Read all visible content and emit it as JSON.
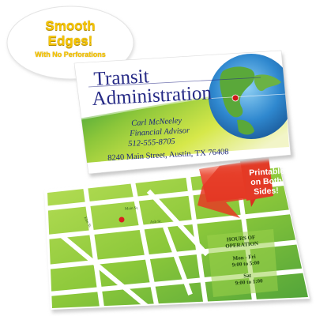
{
  "badge": {
    "line1": "Smooth",
    "line2": "Edges!",
    "line3": "With No Perforations"
  },
  "business_card": {
    "title_line1": "Transit",
    "title_line2": "Administration",
    "name": "Carl McNeeley",
    "role": "Financial Advisor",
    "phone": "512-555-8705",
    "address": "8240 Main Street, Austin, TX 76408"
  },
  "arrow_label": {
    "line1": "Printable",
    "line2": "on Both",
    "line3": "Sides!"
  },
  "map_card": {
    "streets": [
      "Main St.",
      "Ash St.",
      "Elm St."
    ],
    "hours_title_line1": "HOURS OF",
    "hours_title_line2": "OPERATION",
    "days1": "Mon - Fri",
    "time1": "9:00 to 5:00",
    "days2": "Sat",
    "time2": "9:00 to 1:00"
  },
  "colors": {
    "badge_text": "#f6c400",
    "title_text": "#262a86",
    "arrow_red": "#e0301e",
    "map_green": "#86c232",
    "globe_blue": "#2f7cc4"
  }
}
